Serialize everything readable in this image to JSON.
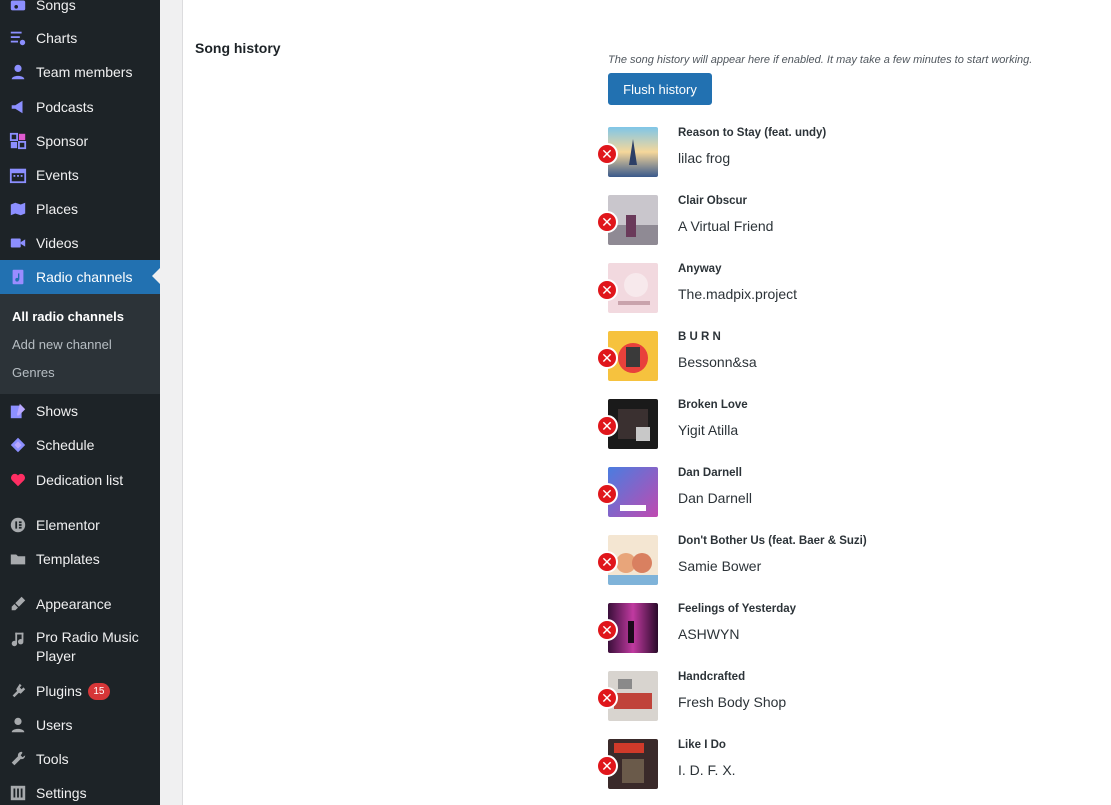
{
  "sidebar": {
    "items": [
      {
        "label": "Songs",
        "icon": "music-note-icon"
      },
      {
        "label": "Charts",
        "icon": "chart-list-icon"
      },
      {
        "label": "Team members",
        "icon": "person-icon"
      },
      {
        "label": "Podcasts",
        "icon": "megaphone-icon"
      },
      {
        "label": "Sponsor",
        "icon": "grid-icon"
      },
      {
        "label": "Events",
        "icon": "calendar-icon"
      },
      {
        "label": "Places",
        "icon": "map-icon"
      },
      {
        "label": "Videos",
        "icon": "video-camera-icon"
      },
      {
        "label": "Radio channels",
        "icon": "audio-file-icon"
      },
      {
        "label": "Shows",
        "icon": "edit-page-icon"
      },
      {
        "label": "Schedule",
        "icon": "ticket-icon"
      },
      {
        "label": "Dedication list",
        "icon": "heart-icon"
      },
      {
        "label": "Elementor",
        "icon": "elementor-icon"
      },
      {
        "label": "Templates",
        "icon": "folder-icon"
      },
      {
        "label": "Appearance",
        "icon": "paintbrush-icon"
      },
      {
        "label": "Pro Radio Music Player",
        "icon": "music-icon"
      },
      {
        "label": "Plugins",
        "icon": "plug-icon",
        "badge": "15"
      },
      {
        "label": "Users",
        "icon": "users-icon"
      },
      {
        "label": "Tools",
        "icon": "wrench-icon"
      },
      {
        "label": "Settings",
        "icon": "sliders-icon"
      }
    ],
    "submenu": [
      "All radio channels",
      "Add new channel",
      "Genres"
    ]
  },
  "section": {
    "title": "Song history",
    "description": "The song history will appear here if enabled. It may take a few minutes to start working.",
    "flush_label": "Flush history"
  },
  "songs": [
    {
      "title": "Reason to Stay (feat. undy)",
      "artist": "lilac frog"
    },
    {
      "title": "Clair Obscur",
      "artist": "A Virtual Friend"
    },
    {
      "title": "Anyway",
      "artist": "The.madpix.project"
    },
    {
      "title": "B U R N",
      "artist": "Bessonn&sa"
    },
    {
      "title": "Broken Love",
      "artist": "Yigit Atilla"
    },
    {
      "title": "Dan Darnell",
      "artist": "Dan Darnell"
    },
    {
      "title": "Don't Bother Us (feat. Baer & Suzi)",
      "artist": "Samie Bower"
    },
    {
      "title": "Feelings of Yesterday",
      "artist": "ASHWYN"
    },
    {
      "title": "Handcrafted",
      "artist": "Fresh Body Shop"
    },
    {
      "title": "Like I Do",
      "artist": "I. D. F. X."
    }
  ],
  "colors": {
    "admin_blue": "#2271b1",
    "sidebar_bg": "#1d2327",
    "delete_red": "#e0161b",
    "accent_icon": "#9b8cff"
  }
}
